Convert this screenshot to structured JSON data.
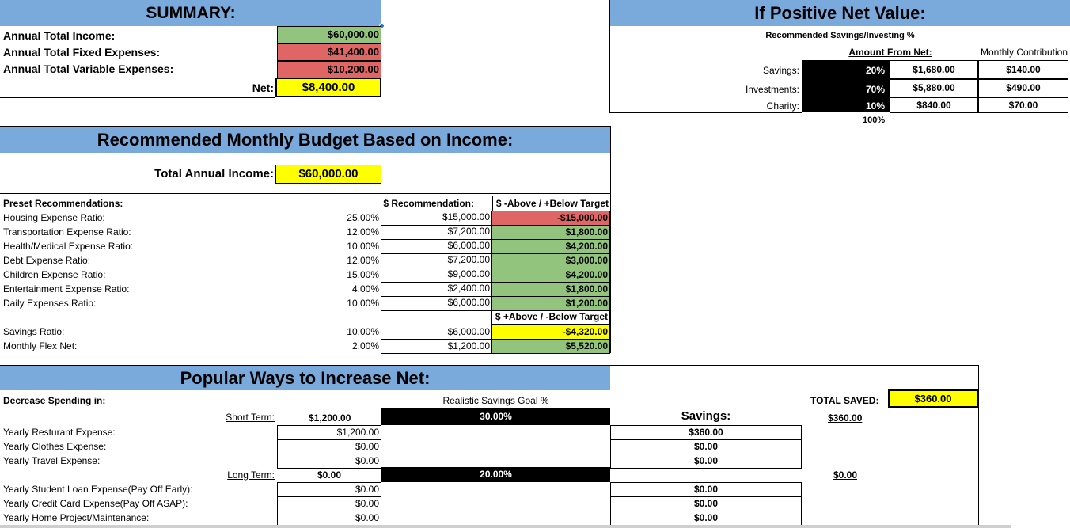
{
  "summary": {
    "title": "SUMMARY:",
    "rows": [
      {
        "label": "Annual Total Income:",
        "value": "$60,000.00"
      },
      {
        "label": "Annual Total Fixed Expenses:",
        "value": "$41,400.00"
      },
      {
        "label": "Annual Total Variable Expenses:",
        "value": "$10,200.00"
      }
    ],
    "net_label": "Net:",
    "net_value": "$8,400.00"
  },
  "positive": {
    "title": "If Positive Net Value:",
    "subtitle": "Recommended Savings/Investing %",
    "amount_header": "Amount From Net:",
    "monthly_header": "Monthly Contribution",
    "rows": [
      {
        "label": "Savings:",
        "pct": "20%",
        "amount": "$1,680.00",
        "monthly": "$140.00"
      },
      {
        "label": "Investments:",
        "pct": "70%",
        "amount": "$5,880.00",
        "monthly": "$490.00"
      },
      {
        "label": "Charity:",
        "pct": "10%",
        "amount": "$840.00",
        "monthly": "$70.00"
      }
    ],
    "total_pct": "100%"
  },
  "budget": {
    "title": "Recommended Monthly Budget Based on Income:",
    "income_label": "Total Annual Income:",
    "income_value": "$60,000.00",
    "preset_header": "Preset Recommendations:",
    "rec_header": "$ Recommendation:",
    "diff_header": "$ -Above / +Below Target",
    "rows": [
      {
        "label": "Housing Expense Ratio:",
        "pct": "25.00%",
        "rec": "$15,000.00",
        "diff": "-$15,000.00",
        "status": "red"
      },
      {
        "label": "Transportation Expense Ratio:",
        "pct": "12.00%",
        "rec": "$7,200.00",
        "diff": "$1,800.00",
        "status": "green"
      },
      {
        "label": "Health/Medical Expense Ratio:",
        "pct": "10.00%",
        "rec": "$6,000.00",
        "diff": "$4,200.00",
        "status": "green"
      },
      {
        "label": "Debt Expense Ratio:",
        "pct": "12.00%",
        "rec": "$7,200.00",
        "diff": "$3,000.00",
        "status": "green"
      },
      {
        "label": "Children Expense Ratio:",
        "pct": "15.00%",
        "rec": "$9,000.00",
        "diff": "$4,200.00",
        "status": "green"
      },
      {
        "label": "Entertainment Expense Ratio:",
        "pct": "4.00%",
        "rec": "$2,400.00",
        "diff": "$1,800.00",
        "status": "green"
      },
      {
        "label": "Daily Expenses Ratio:",
        "pct": "10.00%",
        "rec": "$6,000.00",
        "diff": "$1,200.00",
        "status": "green"
      }
    ],
    "diff2_header": "$ +Above / -Below Target",
    "rows2": [
      {
        "label": "Savings Ratio:",
        "pct": "10.00%",
        "rec": "$6,000.00",
        "diff": "-$4,320.00",
        "status": "yellow"
      },
      {
        "label": "Monthly Flex Net:",
        "pct": "2.00%",
        "rec": "$1,200.00",
        "diff": "$5,520.00",
        "status": "green"
      }
    ]
  },
  "increase": {
    "title": "Popular Ways to Increase Net:",
    "decrease_label": "Decrease Spending in:",
    "goal_header": "Realistic Savings Goal %",
    "total_saved_label": "TOTAL SAVED:",
    "total_saved_value": "$360.00",
    "short_term": {
      "label": "Short Term:",
      "total": "$1,200.00",
      "goal": "30.00%",
      "savings_header": "Savings:",
      "savings_total": "$360.00",
      "rows": [
        {
          "label": "Yearly Resturant Expense:",
          "value": "$1,200.00",
          "saving": "$360.00"
        },
        {
          "label": "Yearly Clothes Expense:",
          "value": "$0.00",
          "saving": "$0.00"
        },
        {
          "label": "Yearly Travel Expense:",
          "value": "$0.00",
          "saving": "$0.00"
        }
      ]
    },
    "long_term": {
      "label": "Long Term:",
      "total": "$0.00",
      "goal": "20.00%",
      "savings_total": "$0.00",
      "rows": [
        {
          "label": "Yearly Student Loan Expense(Pay Off Early):",
          "value": "$0.00",
          "saving": "$0.00"
        },
        {
          "label": "Yearly Credit Card Expense(Pay Off ASAP):",
          "value": "$0.00",
          "saving": "$0.00"
        },
        {
          "label": "Yearly Home Project/Maintenance:",
          "value": "$0.00",
          "saving": "$0.00"
        }
      ]
    }
  },
  "colors": {
    "header_blue": "#7aa9dc",
    "green": "#93c47d",
    "red": "#e06666",
    "yellow": "#ffff00"
  }
}
